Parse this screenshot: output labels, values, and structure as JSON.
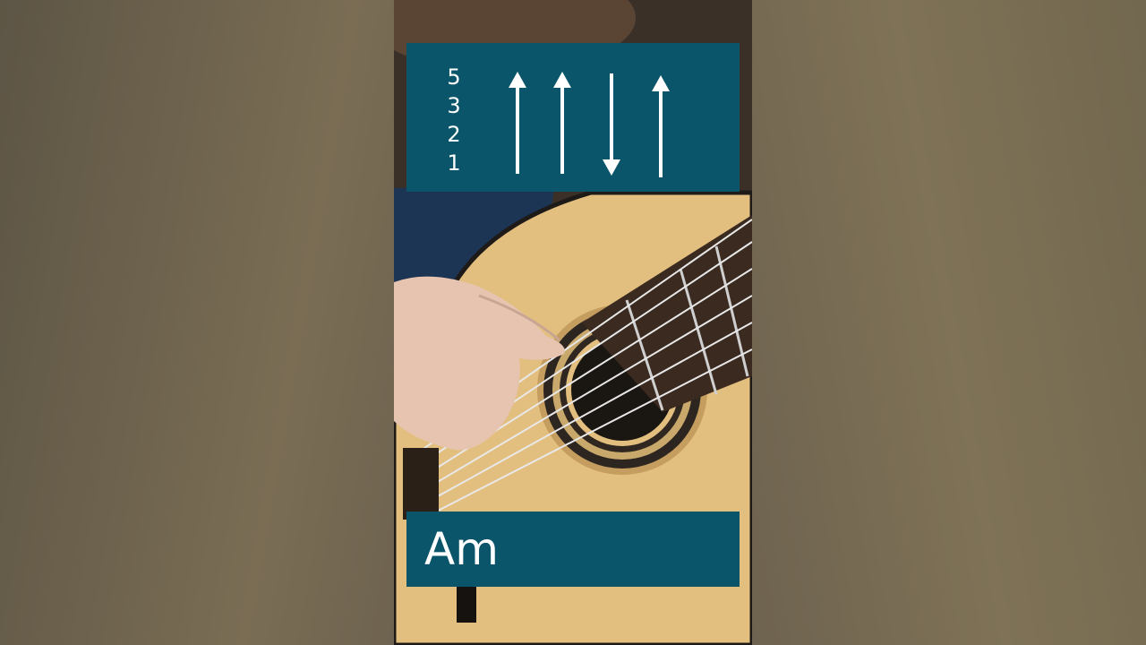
{
  "strum_pattern": {
    "strings": [
      "5",
      "3",
      "2",
      "1"
    ],
    "strokes": [
      "up",
      "up",
      "down",
      "up"
    ]
  },
  "chord": {
    "name": "Am"
  },
  "colors": {
    "panel": "#0a5569",
    "text": "#ffffff",
    "guitar_top": "#e3bf7f"
  },
  "icons": {
    "stroke_up": "arrow-up-icon",
    "stroke_down": "arrow-down-icon"
  }
}
